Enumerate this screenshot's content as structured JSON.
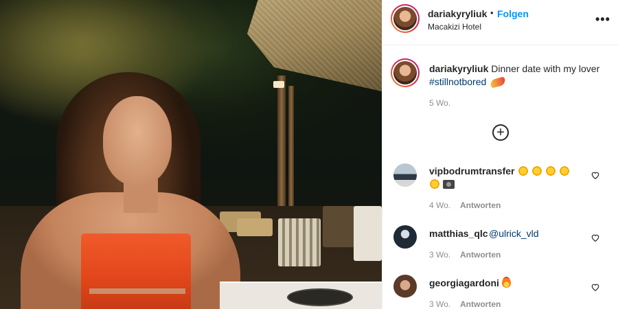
{
  "post": {
    "username": "dariakyryliuk",
    "separator": "•",
    "follow_label": "Folgen",
    "location": "Macakizi Hotel",
    "more_glyph": "•••",
    "caption_user": "dariakyryliuk",
    "caption_text": " Dinner date with my lover ",
    "caption_tag": "#stillnotbored",
    "caption_time": "5 Wo.",
    "load_more_glyph": "+"
  },
  "comments": [
    {
      "user": "vipbodrumtransfer",
      "time": "4 Wo.",
      "reply_label": "Antworten"
    },
    {
      "user": "matthias_qlc",
      "mention": "@ulrick_vld",
      "time": "3 Wo.",
      "reply_label": "Antworten"
    },
    {
      "user": "georgiagardoni",
      "time": "3 Wo.",
      "reply_label": "Antworten"
    }
  ],
  "icons": {
    "more": "more-options-icon",
    "add": "add-circle-icon",
    "like": "heart-icon"
  },
  "colors": {
    "accent": "#0095f6",
    "hashtag": "#00376b",
    "muted": "#8e8e8e",
    "text": "#262626",
    "dress": "#e2461b"
  }
}
